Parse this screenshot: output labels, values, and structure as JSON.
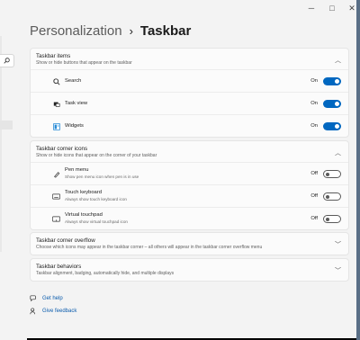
{
  "window": {
    "minimize": "─",
    "maximize": "□",
    "close": "✕"
  },
  "nav": {
    "search_icon": "search-icon"
  },
  "breadcrumb": {
    "parent": "Personalization",
    "separator": "›",
    "current": "Taskbar"
  },
  "sections": {
    "taskbar_items": {
      "title": "Taskbar items",
      "subtitle": "Show or hide buttons that appear on the taskbar",
      "items": [
        {
          "label": "Search",
          "state": "On",
          "icon": "search-icon"
        },
        {
          "label": "Task view",
          "state": "On",
          "icon": "task-view-icon"
        },
        {
          "label": "Widgets",
          "state": "On",
          "icon": "widgets-icon"
        }
      ]
    },
    "corner_icons": {
      "title": "Taskbar corner icons",
      "subtitle": "Show or hide icons that appear on the corner of your taskbar",
      "items": [
        {
          "label": "Pen menu",
          "desc": "Show pen menu icon when pen is in use",
          "state": "Off",
          "icon": "pen-icon"
        },
        {
          "label": "Touch keyboard",
          "desc": "Always show touch keyboard icon",
          "state": "Off",
          "icon": "keyboard-icon"
        },
        {
          "label": "Virtual touchpad",
          "desc": "Always show virtual touchpad icon",
          "state": "Off",
          "icon": "touchpad-icon"
        }
      ]
    },
    "corner_overflow": {
      "title": "Taskbar corner overflow",
      "subtitle": "Choose which icons may appear in the taskbar corner – all others will appear in the taskbar corner overflow menu"
    },
    "behaviors": {
      "title": "Taskbar behaviors",
      "subtitle": "Taskbar alignment, badging, automatically hide, and multiple displays"
    }
  },
  "links": {
    "help": "Get help",
    "feedback": "Give feedback"
  },
  "colors": {
    "accent": "#0067c0",
    "background": "#f3f3f3",
    "card": "#fbfbfb"
  }
}
